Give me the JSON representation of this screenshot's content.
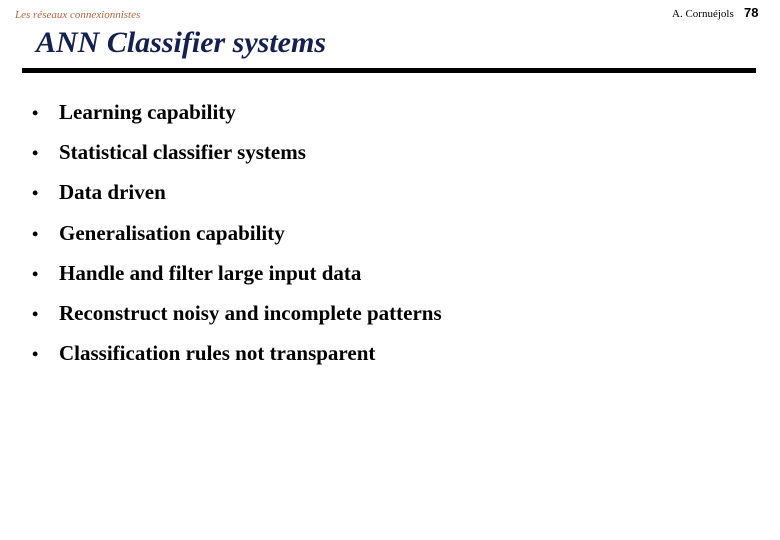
{
  "header": {
    "course": "Les réseaux connexionnistes",
    "author": "A. Cornuéjols",
    "page_number": "78"
  },
  "slide": {
    "title": "ANN Classifier systems",
    "bullet_glyph": "•",
    "bullets": [
      "Learning capability",
      "Statistical classifier systems",
      "Data driven",
      "Generalisation capability",
      "Handle and filter large input data",
      "Reconstruct noisy and incomplete patterns",
      "Classification rules not transparent"
    ]
  },
  "colors": {
    "title": "#142050",
    "header_course": "#b5653a",
    "rule": "#000000"
  }
}
